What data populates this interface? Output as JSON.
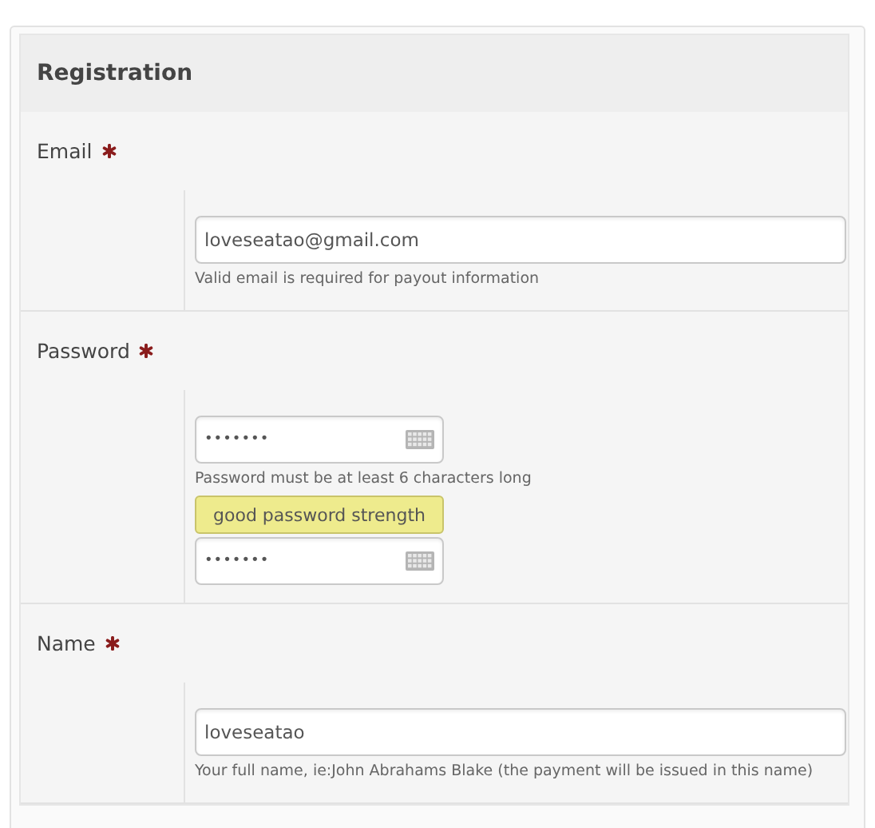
{
  "form": {
    "title": "Registration",
    "fields": [
      {
        "label": "Email",
        "required": true,
        "controls": [
          {
            "kind": "text-input",
            "value": "loveseatao@gmail.com"
          },
          {
            "kind": "hint",
            "text": "Valid email is required for payout information"
          }
        ]
      },
      {
        "label": "Password",
        "required": true,
        "controls": [
          {
            "kind": "password-input",
            "value": "•••••••"
          },
          {
            "kind": "hint",
            "text": "Password must be at least 6 characters long"
          },
          {
            "kind": "strength",
            "text": "good password strength"
          },
          {
            "kind": "password-input",
            "value": "•••••••"
          }
        ]
      },
      {
        "label": "Name",
        "required": true,
        "controls": [
          {
            "kind": "text-input",
            "value": "loveseatao"
          },
          {
            "kind": "hint",
            "text": "Your full name, ie:John Abrahams Blake (the payment will be issued in this name)"
          }
        ]
      }
    ]
  }
}
